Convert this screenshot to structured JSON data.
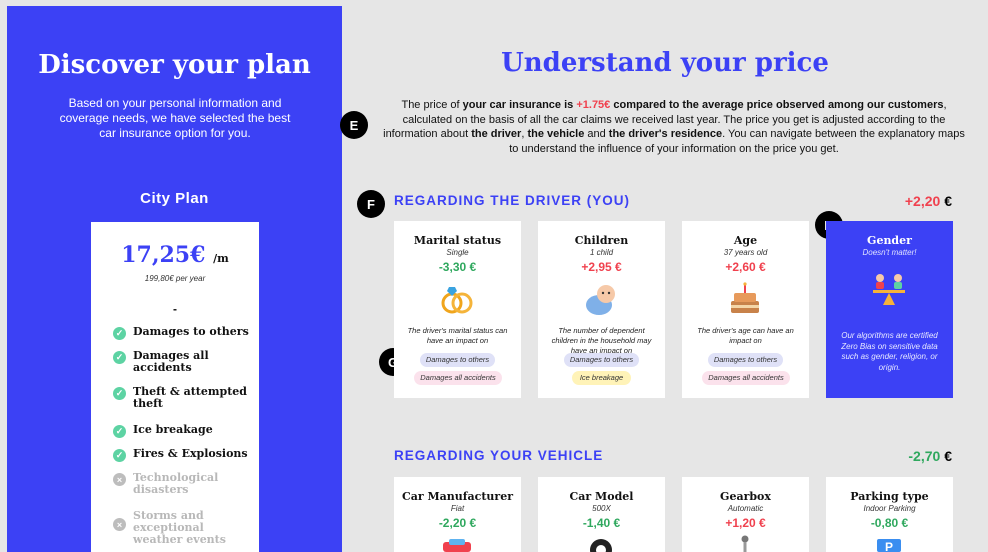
{
  "left": {
    "title": "Discover your plan",
    "subtitle": "Based on your personal information and coverage needs, we have selected the best car insurance option for you.",
    "plan_name": "City Plan",
    "price": "17,25€",
    "price_unit": "/m",
    "price_year": "199,80€ per year",
    "dash": "-",
    "coverages": [
      {
        "label": "Damages to others",
        "included": true
      },
      {
        "label": "Damages all accidents",
        "included": true
      },
      {
        "label": "Theft & attempted theft",
        "included": true
      },
      {
        "label": "Ice breakage",
        "included": true
      },
      {
        "label": "Fires & Explosions",
        "included": true
      },
      {
        "label": "Technological disasters",
        "included": false
      },
      {
        "label": "Storms and exceptional weather events",
        "included": false
      }
    ]
  },
  "main": {
    "title": "Understand your price",
    "intro": {
      "p1": "The price of ",
      "b1": "your car insurance is",
      "neg": "+1.75€",
      "b2": "compared to the average price observed among our customers",
      "p2": ", calculated on the basis of all the car claims we received last year. The price you get is adjusted according to the information about ",
      "b3": "the driver",
      "p3": ", ",
      "b4": "the vehicle",
      "p4": " and ",
      "b5": "the driver's residence",
      "p5": ". You can navigate between the explanatory maps to understand the influence of your information on the price you get."
    },
    "markers": {
      "e": "E",
      "f": "F",
      "g": "G",
      "h": "H"
    }
  },
  "driver": {
    "title": "REGARDING THE DRIVER (YOU)",
    "total_value": "+2,20",
    "total_currency": "€",
    "cards": [
      {
        "title": "Marital status",
        "sub": "Single",
        "value": "-3,30 €",
        "desc": "The driver's marital status can have an impact on",
        "tags": [
          "Damages to others",
          "Damages all accidents"
        ]
      },
      {
        "title": "Children",
        "sub": "1 child",
        "value": "+2,95 €",
        "desc": "The number of dependent children in the household may have an impact on",
        "tags": [
          "Damages to others",
          "Ice breakage"
        ]
      },
      {
        "title": "Age",
        "sub": "37 years old",
        "value": "+2,60 €",
        "desc": "The driver's age can have an impact on",
        "tags": [
          "Damages to others",
          "Damages all accidents"
        ]
      },
      {
        "title": "Gender",
        "sub": "Doesn't matter!",
        "desc": "Our algorithms are certified Zero Bias on sensitive data such as gender, religion, or origin."
      }
    ]
  },
  "vehicle": {
    "title": "REGARDING YOUR VEHICLE",
    "total_value": "-2,70",
    "total_currency": "€",
    "cards": [
      {
        "title": "Car Manufacturer",
        "sub": "Fiat",
        "value": "-2,20 €"
      },
      {
        "title": "Car Model",
        "sub": "500X",
        "value": "-1,40 €"
      },
      {
        "title": "Gearbox",
        "sub": "Automatic",
        "value": "+1,20 €"
      },
      {
        "title": "Parking type",
        "sub": "Indoor Parking",
        "value": "-0,80 €"
      }
    ]
  },
  "colors": {
    "brand": "#3c41f5",
    "negative": "#f0414e",
    "positive": "#2fa85e",
    "check": "#5dd3a3"
  },
  "icons": [
    "check-icon",
    "cross-icon",
    "rings-icon",
    "baby-icon",
    "cake-icon",
    "gender-scale-icon",
    "car-icon",
    "tire-icon",
    "gear-stick-icon",
    "parking-icon"
  ]
}
